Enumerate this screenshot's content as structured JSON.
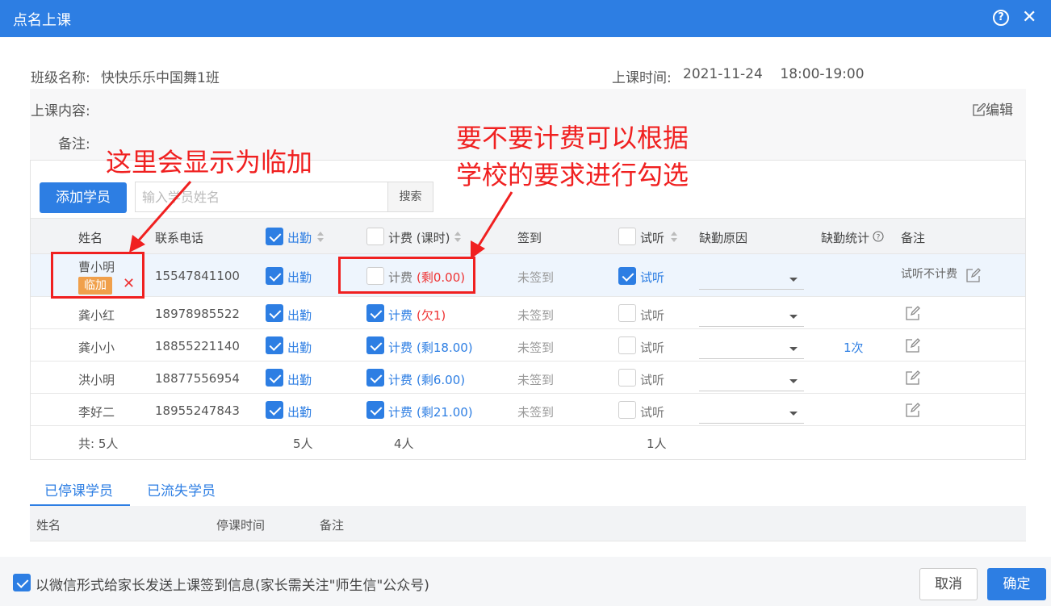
{
  "dialog": {
    "title": "点名上课",
    "help_glyph": "?",
    "close_glyph": "✕"
  },
  "info": {
    "class_name_label": "班级名称:",
    "class_name": "快快乐乐中国舞1班",
    "time_label": "上课时间:",
    "time_value": "2021-11-24    18:00-19:00",
    "content_label": "上课内容:",
    "remark_label": "备注:",
    "edit_label": "编辑"
  },
  "toolbar": {
    "add_label": "添加学员",
    "search_placeholder": "输入学员姓名",
    "search_label": "搜索"
  },
  "table": {
    "headers": {
      "name": "姓名",
      "phone": "联系电话",
      "attend": "出勤",
      "fee": "计费 (课时)",
      "signin": "签到",
      "trial": "试听",
      "reason": "缺勤原因",
      "stat": "缺勤统计",
      "remark": "备注"
    },
    "rows": [
      {
        "name": "曹小明",
        "badge": "临加",
        "phone": "15547841100",
        "attend": true,
        "attend_label": "出勤",
        "fee_checked": false,
        "fee_label": "计费",
        "fee_balance": "(剩0.00)",
        "signin": "未签到",
        "trial_checked": true,
        "trial_label": "试听",
        "stat": "",
        "remark_text": "试听不计费"
      },
      {
        "name": "龚小红",
        "phone": "18978985522",
        "attend": true,
        "attend_label": "出勤",
        "fee_checked": true,
        "fee_label": "计费",
        "fee_balance": "(欠1)",
        "signin": "未签到",
        "trial_checked": false,
        "trial_label": "试听",
        "stat": "",
        "remark_text": ""
      },
      {
        "name": "龚小小",
        "phone": "18855221140",
        "attend": true,
        "attend_label": "出勤",
        "fee_checked": true,
        "fee_label": "计费",
        "fee_balance": "(剩18.00)",
        "signin": "未签到",
        "trial_checked": false,
        "trial_label": "试听",
        "stat": "1次",
        "remark_text": ""
      },
      {
        "name": "洪小明",
        "phone": "18877556954",
        "attend": true,
        "attend_label": "出勤",
        "fee_checked": true,
        "fee_label": "计费",
        "fee_balance": "(剩6.00)",
        "signin": "未签到",
        "trial_checked": false,
        "trial_label": "试听",
        "stat": "",
        "remark_text": ""
      },
      {
        "name": "李好二",
        "phone": "18955247843",
        "attend": true,
        "attend_label": "出勤",
        "fee_checked": true,
        "fee_label": "计费",
        "fee_balance": "(剩21.00)",
        "signin": "未签到",
        "trial_checked": false,
        "trial_label": "试听",
        "stat": "",
        "remark_text": ""
      }
    ],
    "summary": {
      "total": "共: 5人",
      "attend": "5人",
      "fee": "4人",
      "trial": "1人"
    }
  },
  "annotations": {
    "left": "这里会显示为临加",
    "right_line1": "要不要计费可以根据",
    "right_line2": "学校的要求进行勾选",
    "color": "#f02020"
  },
  "tabs": {
    "suspended": "已停课学员",
    "lost": "已流失学员"
  },
  "suspended_table": {
    "name": "姓名",
    "time": "停课时间",
    "remark": "备注"
  },
  "footer": {
    "wechat_checked": true,
    "wechat_label": "以微信形式给家长发送上课签到信息(家长需关注\"师生信\"公众号)",
    "cancel": "取消",
    "confirm": "确定"
  },
  "colors": {
    "primary": "#2d7ee3",
    "danger": "#e33",
    "badge": "#f0a04b"
  }
}
